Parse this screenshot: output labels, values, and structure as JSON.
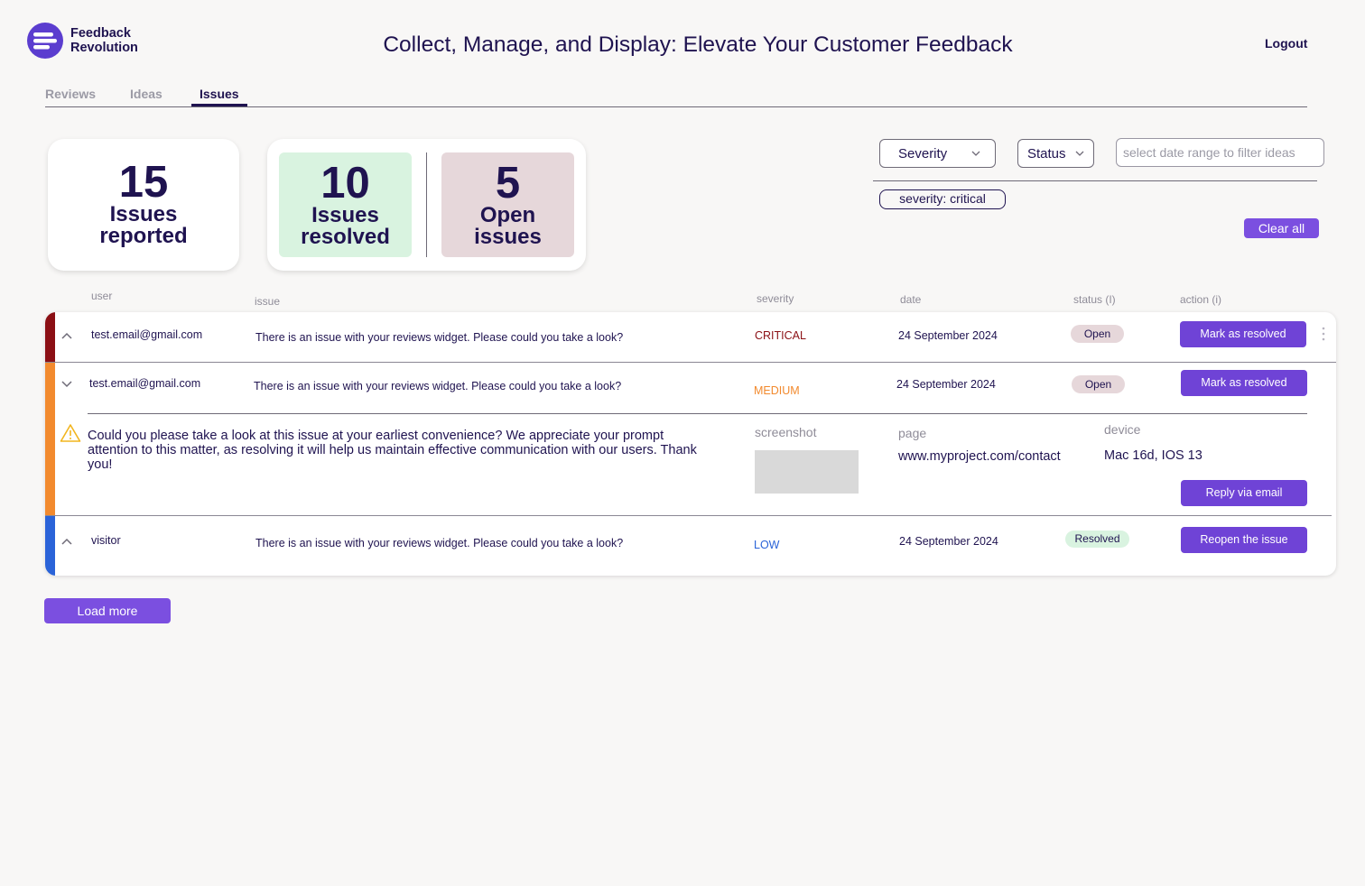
{
  "app": {
    "brand_line1": "Feedback",
    "brand_line2": "Revolution",
    "title": "Collect, Manage, and Display: Elevate Your Customer Feedback",
    "logout": "Logout",
    "accent": "#6f43d6"
  },
  "tabs": [
    {
      "label": "Reviews",
      "active": false
    },
    {
      "label": "Ideas",
      "active": false
    },
    {
      "label": "Issues",
      "active": true
    }
  ],
  "stats": {
    "reported": {
      "value": "15",
      "line1": "Issues",
      "line2": "reported"
    },
    "resolved": {
      "value": "10",
      "line1": "Issues",
      "line2": "resolved",
      "color": "#d9f3e0"
    },
    "open": {
      "value": "5",
      "line1": "Open",
      "line2": "issues",
      "color": "#e6d7da"
    }
  },
  "filters": {
    "severity": "Severity",
    "status": "Status",
    "date_placeholder": "select date range to filter ideas",
    "chip": "severity: critical",
    "clear_all": "Clear all"
  },
  "columns": {
    "user": "user",
    "issue": "issue",
    "severity": "severity",
    "date": "date",
    "status": "status (I)",
    "action": "action (i)"
  },
  "rows": [
    {
      "user": "test.email@gmail.com",
      "issue": "There is an issue with your reviews widget. Please could you take a look?",
      "severity": "CRITICAL",
      "severity_color": "#8b0f14",
      "date": "24 September 2024",
      "status": "Open",
      "action": "Mark as resolved",
      "expanded": false
    },
    {
      "user": "test.email@gmail.com",
      "issue": "There is an issue with your reviews widget. Please could you take a look?",
      "severity": "MEDIUM",
      "severity_color": "#f28a2e",
      "date": "24 September 2024",
      "status": "Open",
      "action": "Mark as resolved",
      "expanded": true,
      "details": {
        "message": "Could you please take a look at this issue at your earliest convenience? We appreciate your prompt attention to this matter, as resolving it will help us maintain effective communication with our users. Thank you!",
        "screenshot_label": "screenshot",
        "page_label": "page",
        "page_value": "www.myproject.com/contact",
        "device_label": "device",
        "device_value": "Mac 16d, IOS 13",
        "reply": "Reply via email"
      }
    },
    {
      "user": "visitor",
      "issue": "There is an issue with your reviews widget. Please could you take a look?",
      "severity": "LOW",
      "severity_color": "#2a63d8",
      "date": "24 September 2024",
      "status": "Resolved",
      "action": "Reopen the issue",
      "expanded": false
    }
  ],
  "load_more": "Load more"
}
